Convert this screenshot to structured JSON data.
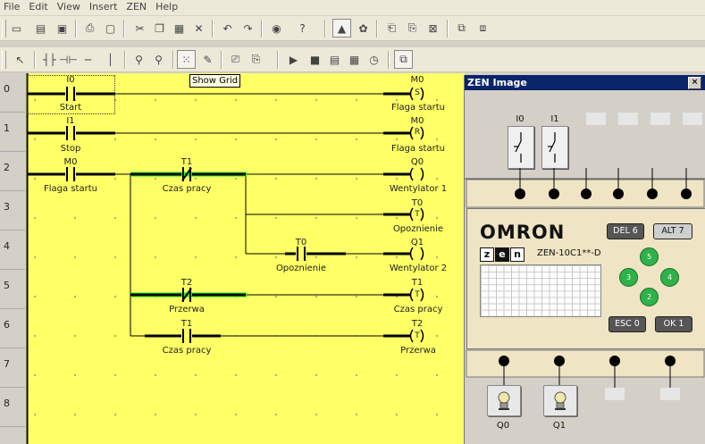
{
  "menu": [
    "File",
    "Edit",
    "View",
    "Insert",
    "ZEN",
    "Help"
  ],
  "tooltip": "Show Grid",
  "row_numbers": [
    "0",
    "1",
    "2",
    "3",
    "4",
    "5",
    "6",
    "7",
    "8"
  ],
  "rungs": [
    {
      "label_top": "I0",
      "label_bottom": "Start",
      "coil_top": "M0",
      "coil_symbol": "S",
      "coil_bottom": "Flaga startu"
    },
    {
      "label_top": "I1",
      "label_bottom": "Stop",
      "coil_top": "M0",
      "coil_symbol": "R",
      "coil_bottom": "Flaga startu"
    },
    {
      "label_top": "M0",
      "label_bottom": "Flaga startu",
      "c2_top": "T1",
      "c2_bottom": "Czas pracy",
      "coil_top": "Q0",
      "coil_bottom": "Wentylator 1"
    },
    {
      "coil_top": "T0",
      "coil_symbol": "T",
      "coil_bottom": "Opoznienie"
    },
    {
      "c3_top": "T0",
      "c3_bottom": "Opoznienie",
      "coil_top": "Q1",
      "coil_bottom": "Wentylator 2"
    },
    {
      "c2_top": "T2",
      "c2_bottom": "Przerwa",
      "coil_top": "T1",
      "coil_symbol": "T",
      "coil_bottom": "Czas pracy"
    },
    {
      "c2_top": "T1",
      "c2_bottom": "Czas pracy",
      "coil_top": "T2",
      "coil_symbol": "T",
      "coil_bottom": "Przerwa"
    }
  ],
  "zen": {
    "title": "ZEN Image",
    "close": "×",
    "inputs": [
      "I0",
      "I1"
    ],
    "brand": "OMRON",
    "zen_letters": [
      "z",
      "e",
      "n"
    ],
    "model": "ZEN-10C1**-D",
    "keys": {
      "del": "DEL 6",
      "alt": "ALT 7",
      "esc": "ESC 0",
      "ok": "OK 1",
      "up": "5",
      "left": "3",
      "right": "4",
      "down": "2"
    },
    "outputs": [
      "Q0",
      "Q1"
    ]
  },
  "colors": {
    "ladder_bg": "#ffff66",
    "active": "#22ee22",
    "title_bar": "#0a246a"
  }
}
